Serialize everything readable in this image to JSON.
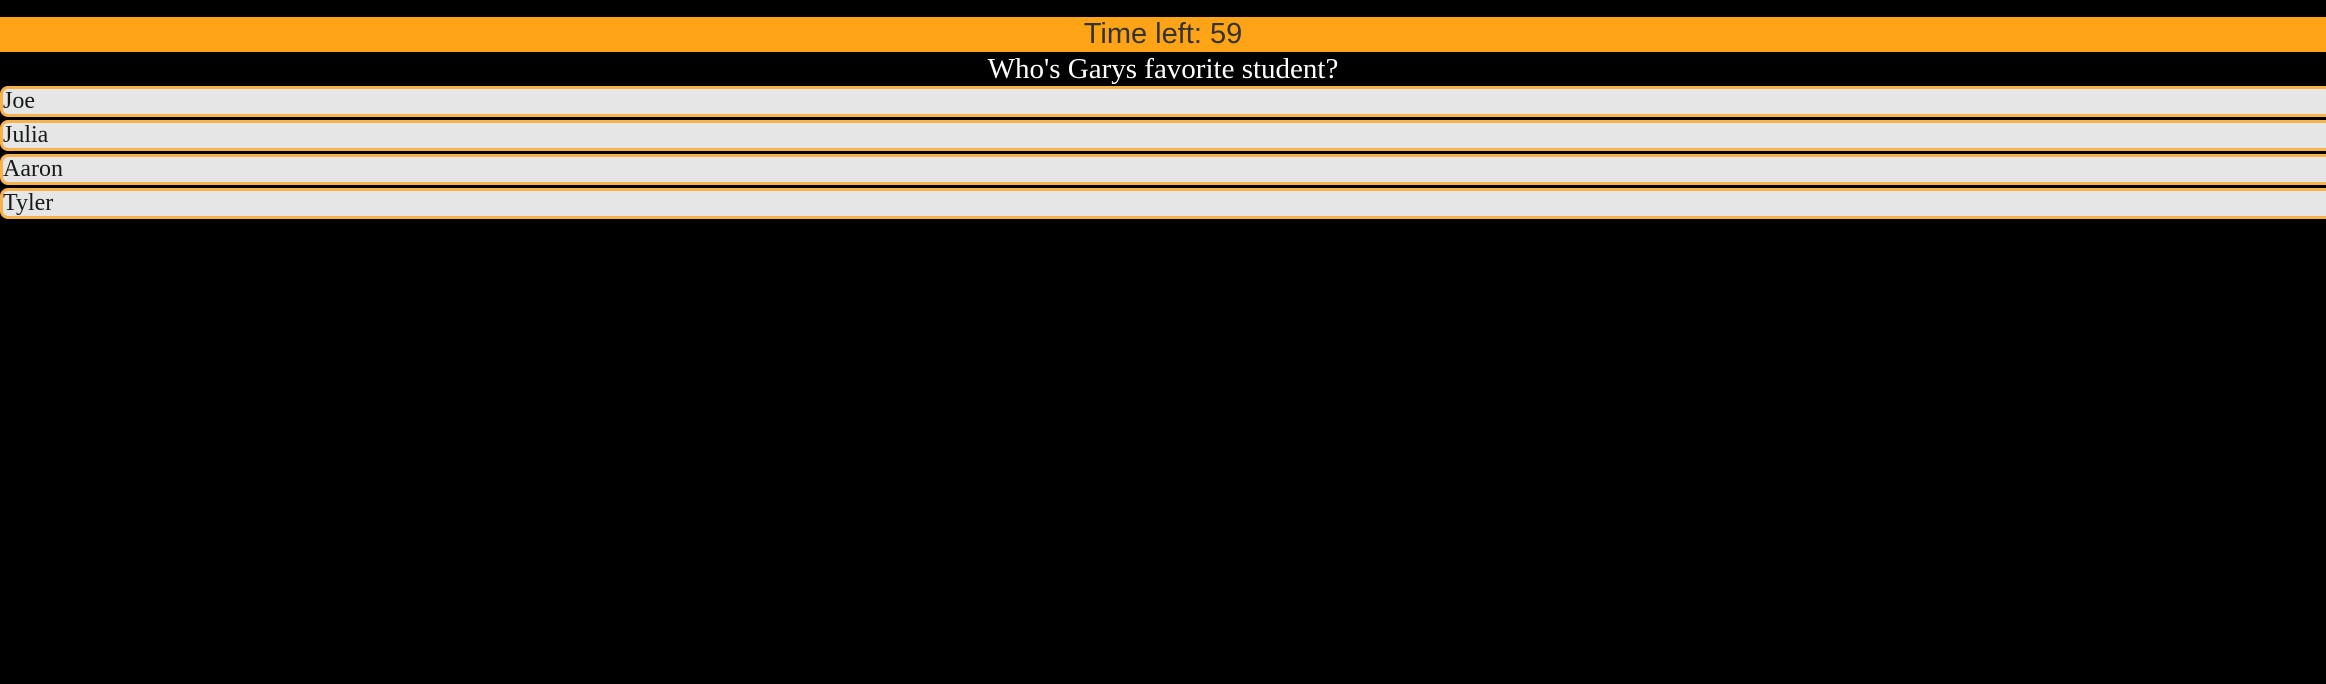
{
  "timer": {
    "label": "Time left: 59"
  },
  "question": {
    "text": "Who's Garys favorite student?"
  },
  "answers": [
    {
      "label": "Joe"
    },
    {
      "label": "Julia"
    },
    {
      "label": "Aaron"
    },
    {
      "label": "Tyler"
    }
  ],
  "colors": {
    "timer_bar": "#ffa317",
    "answer_border": "#f7b24a",
    "answer_background": "#e6e6e6",
    "page_background": "#000000",
    "question_text": "#ffffff"
  }
}
